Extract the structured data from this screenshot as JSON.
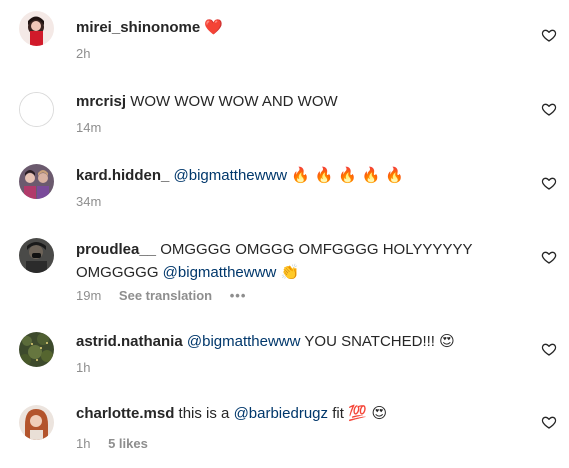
{
  "comments": [
    {
      "username": "mirei_shinonome",
      "parts": [
        {
          "text": "❤️",
          "kind": "emoji"
        }
      ],
      "time": "2h"
    },
    {
      "username": "mrcrisj",
      "parts": [
        {
          "text": "WOW WOW WOW AND WOW",
          "kind": "text"
        }
      ],
      "time": "14m"
    },
    {
      "username": "kard.hidden_",
      "parts": [
        {
          "text": "@bigmatthewww",
          "kind": "mention"
        },
        {
          "text": "🔥 🔥 🔥 🔥 🔥",
          "kind": "emoji"
        }
      ],
      "time": "34m"
    },
    {
      "username": "proudlea__",
      "parts": [
        {
          "text": "OMGGGG OMGGG OMFGGGG HOLYYYYYY OMGGGGG",
          "kind": "text"
        },
        {
          "text": "@bigmatthewww",
          "kind": "mention"
        },
        {
          "text": "👏",
          "kind": "emoji"
        }
      ],
      "time": "19m",
      "translate": "See translation",
      "more": "•••"
    },
    {
      "username": "astrid.nathania",
      "parts": [
        {
          "text": "@bigmatthewww",
          "kind": "mention"
        },
        {
          "text": "YOU SNATCHED!!!",
          "kind": "text"
        },
        {
          "text": "😍",
          "kind": "emoji"
        }
      ],
      "time": "1h"
    },
    {
      "username": "charlotte.msd",
      "parts": [
        {
          "text": "this is a",
          "kind": "text"
        },
        {
          "text": "@barbiedrugz",
          "kind": "mention"
        },
        {
          "text": "fit",
          "kind": "text"
        },
        {
          "text": "💯 😍",
          "kind": "emoji"
        }
      ],
      "time": "1h",
      "likes": "5 likes"
    }
  ],
  "colors": {
    "text": "#262626",
    "mention": "#00376b",
    "meta": "#8e8e8e"
  },
  "icons": {
    "like": "heart-outline-icon"
  }
}
